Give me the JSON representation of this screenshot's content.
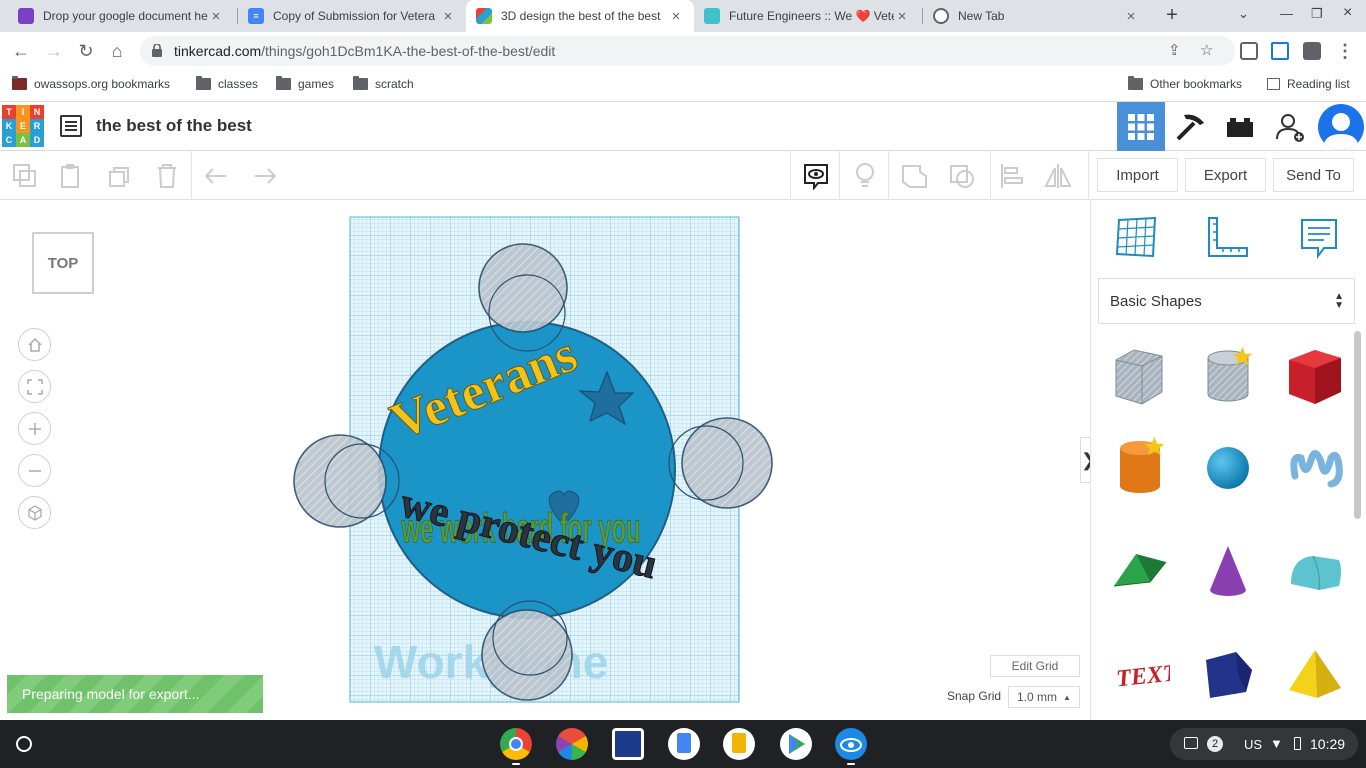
{
  "browser": {
    "tabs": [
      {
        "title": "Drop your google document he",
        "favicon": "purple-doc-icon",
        "active": false
      },
      {
        "title": "Copy of Submission for Vetera",
        "favicon": "google-docs-icon",
        "active": false
      },
      {
        "title": "3D design the best of the best",
        "favicon": "tinkercad-icon",
        "active": true
      },
      {
        "title": "Future Engineers :: We ❤️ Vete",
        "favicon": "future-engineers-icon",
        "active": false
      },
      {
        "title": "New Tab",
        "favicon": "chrome-icon",
        "active": false
      }
    ],
    "url_host": "tinkercad.com",
    "url_path": "/things/goh1DcBm1KA-the-best-of-the-best/edit",
    "bookmarks": [
      "owassops.org bookmarks",
      "classes",
      "games",
      "scratch"
    ],
    "other_bookmarks": "Other bookmarks",
    "reading_list": "Reading list"
  },
  "tinkercad": {
    "logo_letters": [
      "T",
      "I",
      "N",
      "K",
      "E",
      "R",
      "C",
      "A",
      "D"
    ],
    "logo_colors": [
      "#e8412e",
      "#f7941d",
      "#e8412e",
      "#2a9fd6",
      "#f7941d",
      "#2a9fd6",
      "#2a9fd6",
      "#7ac143",
      "#2a9fd6"
    ],
    "design_title": "the best of the best",
    "toolbar": {
      "import_label": "Import",
      "export_label": "Export",
      "send_to_label": "Send To"
    },
    "viewcube_label": "TOP",
    "scene": {
      "text_veterans": "Veterans",
      "text_work_hard": "we work hard for you",
      "text_protect": "we protect you",
      "workplane_label": "Workplane"
    },
    "edit_grid_label": "Edit Grid",
    "snap_grid_label": "Snap Grid",
    "snap_grid_value": "1.0 mm",
    "status_message": "Preparing model for export...",
    "panel_toggle": "❯",
    "shape_category": "Basic Shapes"
  },
  "shelf": {
    "notification_count": "2",
    "keyboard_layout": "US",
    "time": "10:29"
  }
}
